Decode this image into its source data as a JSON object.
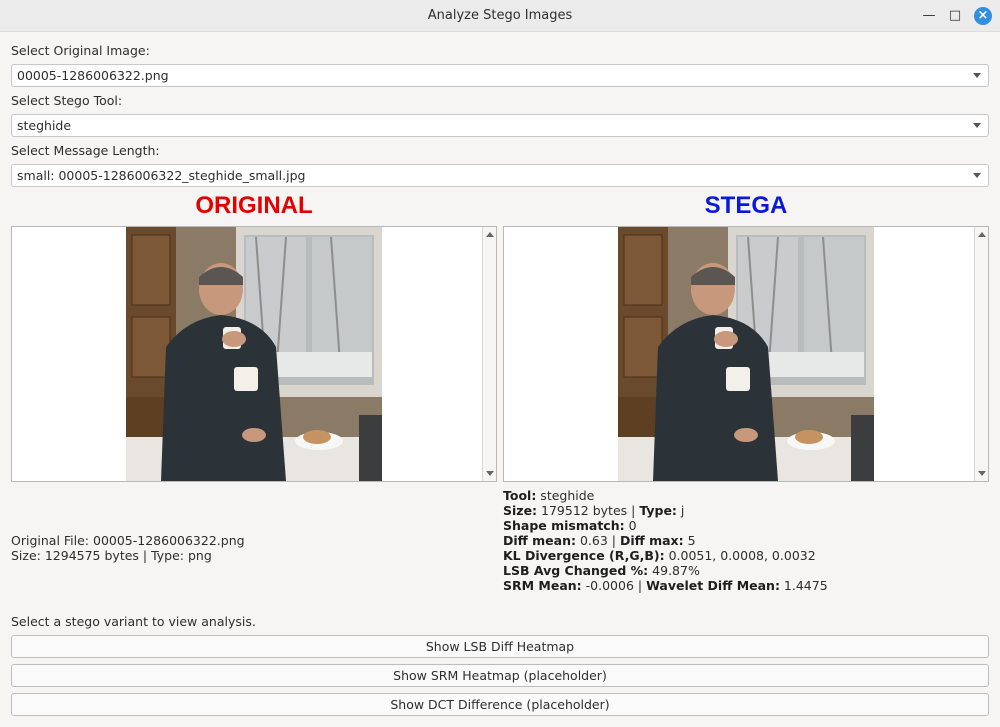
{
  "window": {
    "title": "Analyze Stego Images"
  },
  "labels": {
    "original_image": "Select Original Image:",
    "stego_tool": "Select Stego Tool:",
    "message_length": "Select Message Length:"
  },
  "selects": {
    "original_image": "00005-1286006322.png",
    "stego_tool": "steghide",
    "message_length": "small: 00005-1286006322_steghide_small.jpg"
  },
  "headers": {
    "original": "ORIGINAL",
    "stega": "STEGA"
  },
  "original_info": {
    "file_line": "Original File: 00005-1286006322.png",
    "size_line": "Size: 1294575 bytes | Type: png"
  },
  "stego_info": {
    "tool_label": "Tool:",
    "tool_value": " steghide",
    "size_label": "Size:",
    "size_value": " 179512 bytes | ",
    "type_label": "Type:",
    "type_value": " j",
    "shape_label": "Shape mismatch:",
    "shape_value": " 0",
    "diff_mean_label": "Diff mean:",
    "diff_mean_value": " 0.63 | ",
    "diff_max_label": "Diff max:",
    "diff_max_value": " 5",
    "kl_label": "KL Divergence (R,G,B):",
    "kl_value": " 0.0051, 0.0008, 0.0032",
    "lsb_label": "LSB Avg Changed %:",
    "lsb_value": " 49.87%",
    "srm_label": "SRM Mean:",
    "srm_value": " -0.0006 | ",
    "wavelet_label": "Wavelet Diff Mean:",
    "wavelet_value": " 1.4475"
  },
  "status": "Select a stego variant to view analysis.",
  "buttons": {
    "lsb": "Show LSB Diff Heatmap",
    "srm": "Show SRM Heatmap (placeholder)",
    "dct": "Show DCT Difference (placeholder)"
  },
  "colors": {
    "original_header": "#e50000",
    "stega_header": "#0a1adb",
    "close_button": "#2f8fe0"
  }
}
